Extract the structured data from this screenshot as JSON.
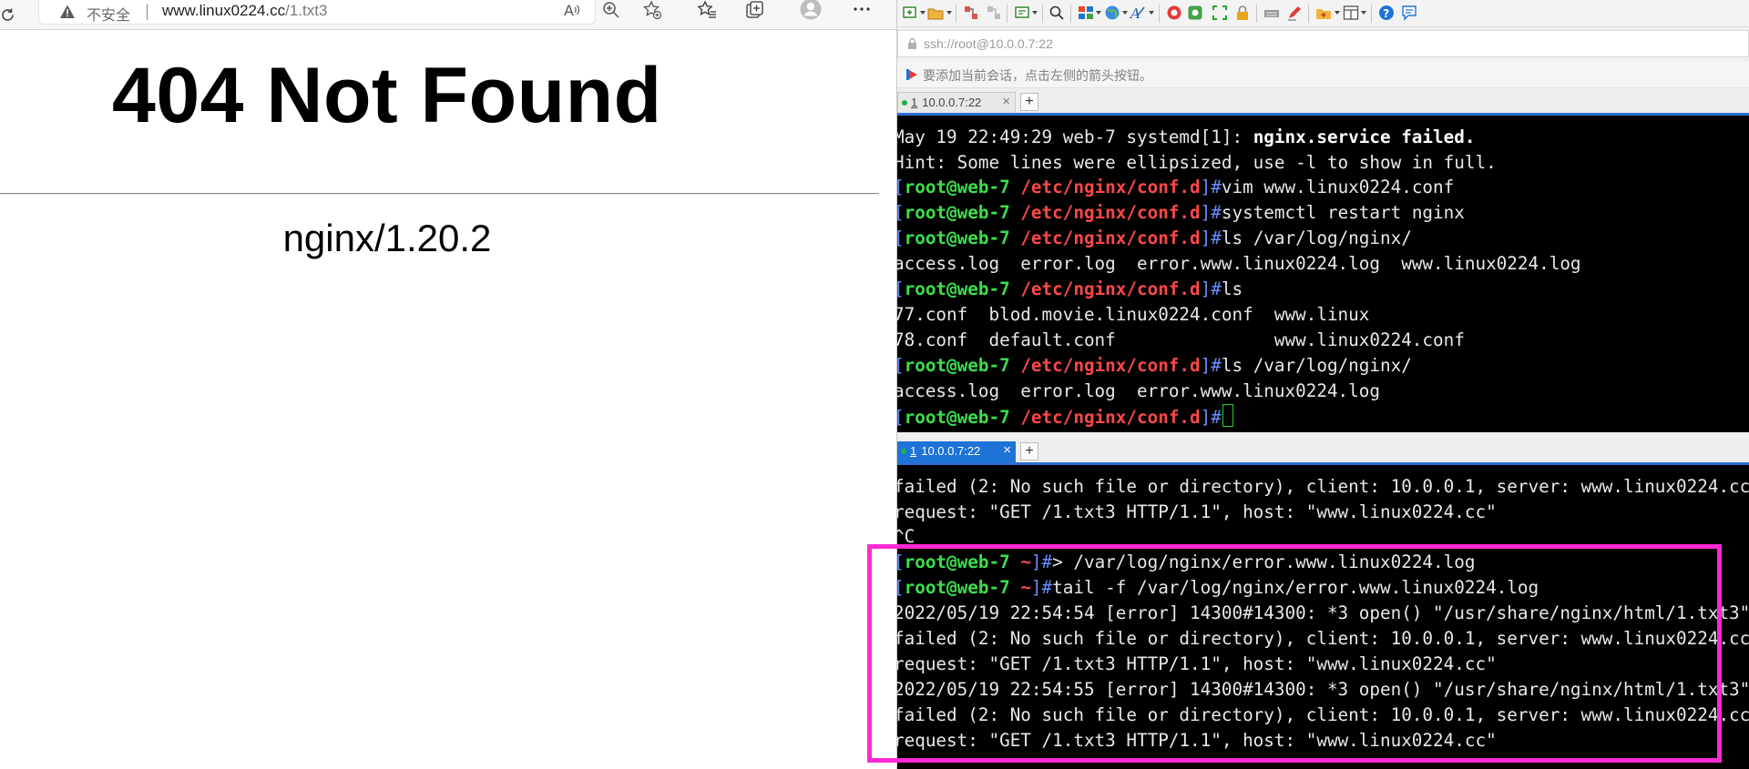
{
  "browser": {
    "insecure_label": "不安全",
    "url_host": "www.linux0224.cc",
    "url_path": "/1.txt3",
    "heading": "404 Not Found",
    "server_version": "nginx/1.20.2"
  },
  "xshell": {
    "address": "ssh://root@10.0.0.7:22",
    "hint": "要添加当前会话，点击左侧的箭头按钮。",
    "tab_number": "1",
    "tab_title": "10.0.0.7:22",
    "tab_close": "×",
    "tab_add": "+",
    "prompt": {
      "open": "[",
      "user_host": "root@web-7",
      "dir_conf": "/etc/nginx/conf.d",
      "dir_home": "~",
      "close": "]#"
    },
    "term1": {
      "l0_prefix": "May 19 22:49:29 web-7 systemd[1]: ",
      "l0_bold": "nginx.service failed.",
      "l1": "Hint: Some lines were ellipsized, use -l to show in full.",
      "c2": "vim www.linux0224.conf",
      "c3": "systemctl restart nginx",
      "c4": "ls /var/log/nginx/",
      "l5": "access.log  error.log  error.www.linux0224.log  www.linux0224.log",
      "c6": "ls",
      "l7": "77.conf  blod.movie.linux0224.conf  www.linux",
      "l8": "78.conf  default.conf               www.linux0224.conf",
      "c9": "ls /var/log/nginx/",
      "l10": "access.log  error.log  error.www.linux0224.log",
      "c11": ""
    },
    "term2": {
      "l0": "failed (2: No such file or directory), client: 10.0.0.1, server: www.linux0224.cc",
      "l1": "request: \"GET /1.txt3 HTTP/1.1\", host: \"www.linux0224.cc\"",
      "l2": "^C",
      "c3": "> /var/log/nginx/error.www.linux0224.log",
      "c4": "tail -f /var/log/nginx/error.www.linux0224.log",
      "l5": "2022/05/19 22:54:54 [error] 14300#14300: *3 open() \"/usr/share/nginx/html/1.txt3\"",
      "l6": "failed (2: No such file or directory), client: 10.0.0.1, server: www.linux0224.cc",
      "l7": "request: \"GET /1.txt3 HTTP/1.1\", host: \"www.linux0224.cc\"",
      "l8": "2022/05/19 22:54:55 [error] 14300#14300: *3 open() \"/usr/share/nginx/html/1.txt3\"",
      "l9": "failed (2: No such file or directory), client: 10.0.0.1, server: www.linux0224.cc",
      "l10": "request: \"GET /1.txt3 HTTP/1.1\", host: \"www.linux0224.cc\""
    }
  },
  "icons": {
    "browser": [
      "reload-icon",
      "warning-icon",
      "read-aloud-icon",
      "zoom-icon",
      "favorite-add-icon",
      "favorites-icon",
      "collections-icon",
      "profile-icon",
      "more-icon"
    ],
    "xshell": [
      "new-session-icon",
      "open-folder-icon",
      "connect-icon",
      "disconnect-icon",
      "properties-icon",
      "find-icon",
      "layout-icon",
      "globe-icon",
      "font-icon",
      "xftp-icon",
      "xmanager-icon",
      "fullscreen-icon",
      "lock-icon",
      "keyboard-icon",
      "highlight-icon",
      "compose-icon",
      "split-icon",
      "help-icon",
      "chat-icon"
    ]
  },
  "colors": {
    "prompt_user": "#3cde4c",
    "prompt_dir": "#ff4848",
    "prompt_bracket": "#6a8cff",
    "tab_active": "#1e73d8",
    "highlight_box": "#ff2ad4",
    "cursor": "#1fd31f"
  }
}
